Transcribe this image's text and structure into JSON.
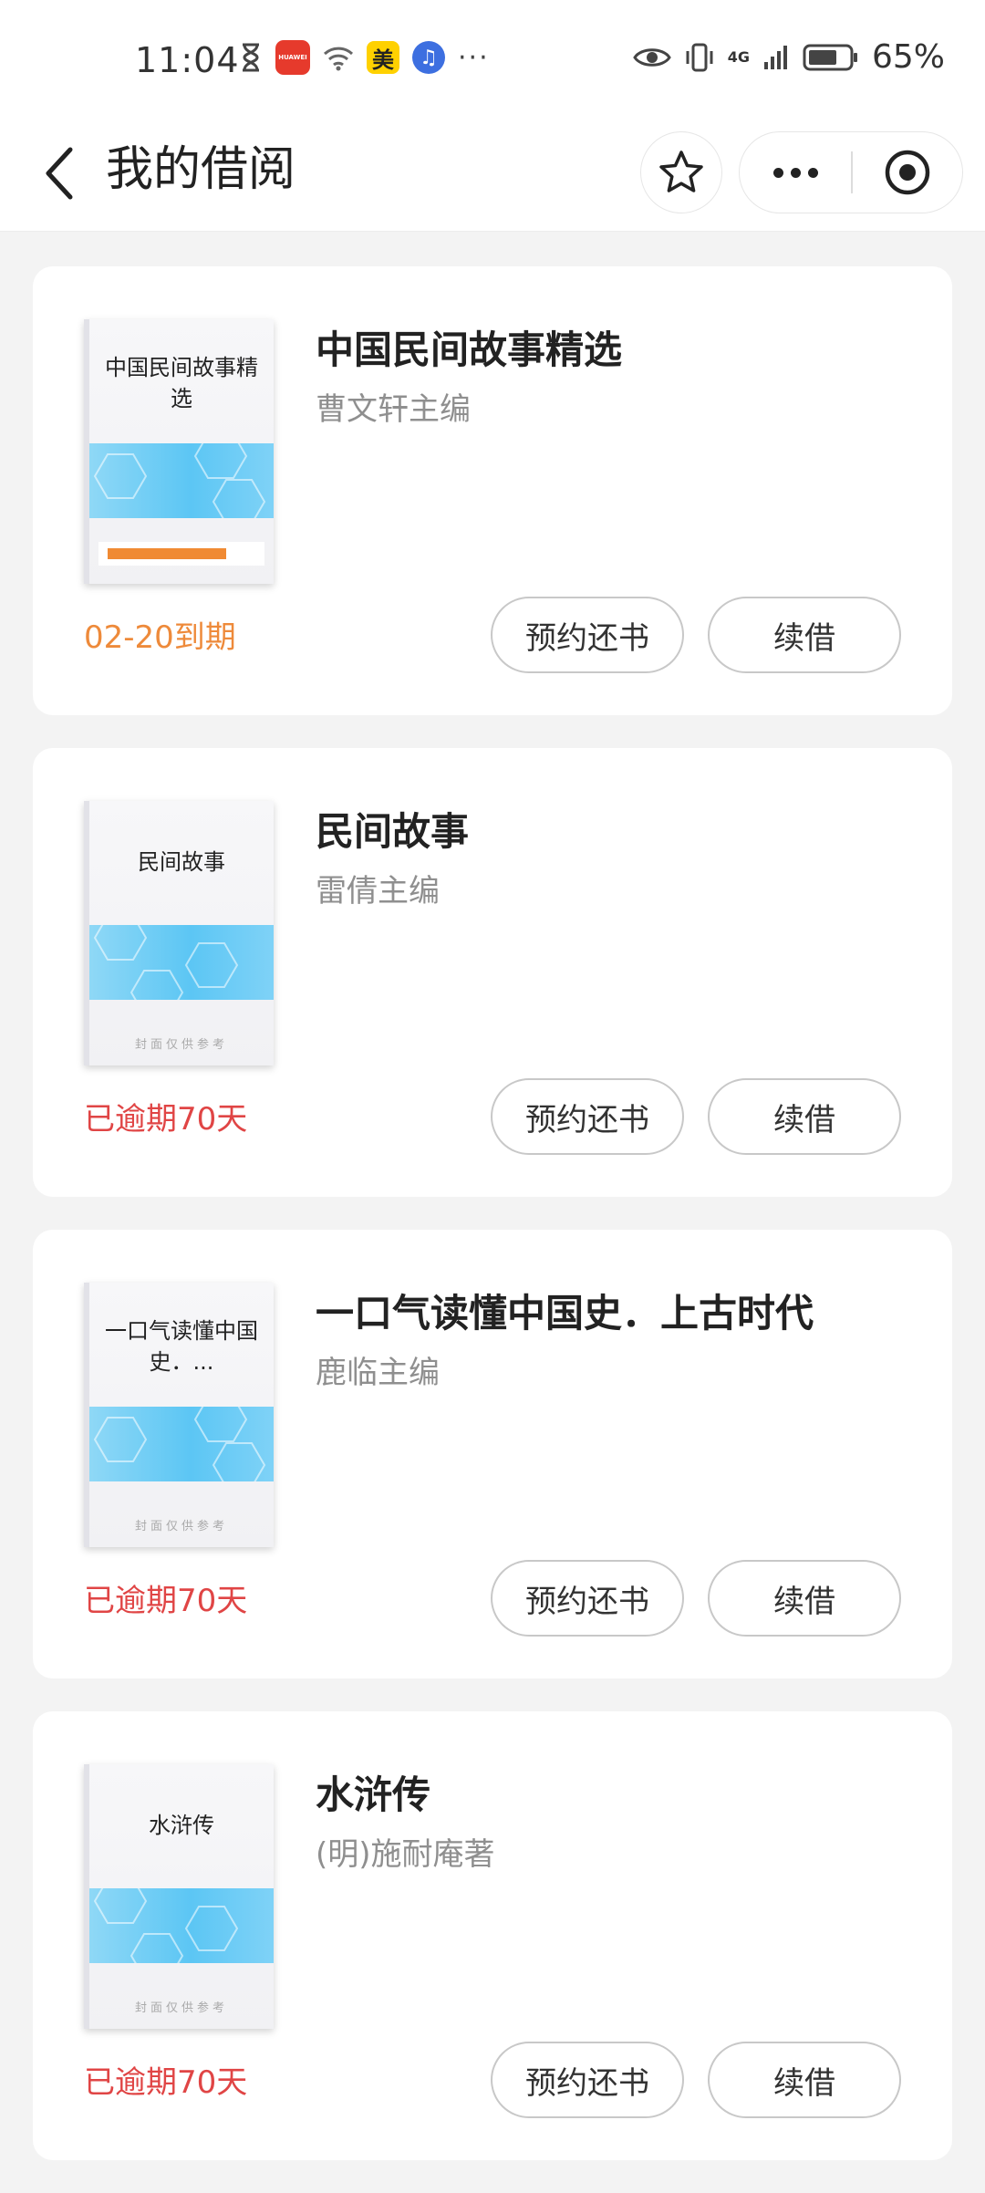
{
  "status_bar": {
    "time": "11:04",
    "huawei_label": "HUAWEI",
    "mei_label": "美",
    "more": "···",
    "network": "4G",
    "battery": "65%"
  },
  "nav": {
    "title": "我的借阅"
  },
  "actions": {
    "reserve_return": "预约还书",
    "renew": "续借"
  },
  "cover_note": "封面仅供参考",
  "books": [
    {
      "cover_title": "中国民间故事精选",
      "title": "中国民间故事精选",
      "author": "曹文轩主编",
      "due": "02-20到期",
      "due_color": "#ee8a3a",
      "progress": 0.75
    },
    {
      "cover_title": "民间故事",
      "title": "民间故事",
      "author": "雷倩主编",
      "due": "已逾期70天",
      "due_color": "#e04545"
    },
    {
      "cover_title": "一口气读懂中国史．...",
      "title": "一口气读懂中国史．上古时代",
      "author": "鹿临主编",
      "due": "已逾期70天",
      "due_color": "#e04545"
    },
    {
      "cover_title": "水浒传",
      "title": "水浒传",
      "author": "(明)施耐庵著",
      "due": "已逾期70天",
      "due_color": "#e04545"
    }
  ]
}
